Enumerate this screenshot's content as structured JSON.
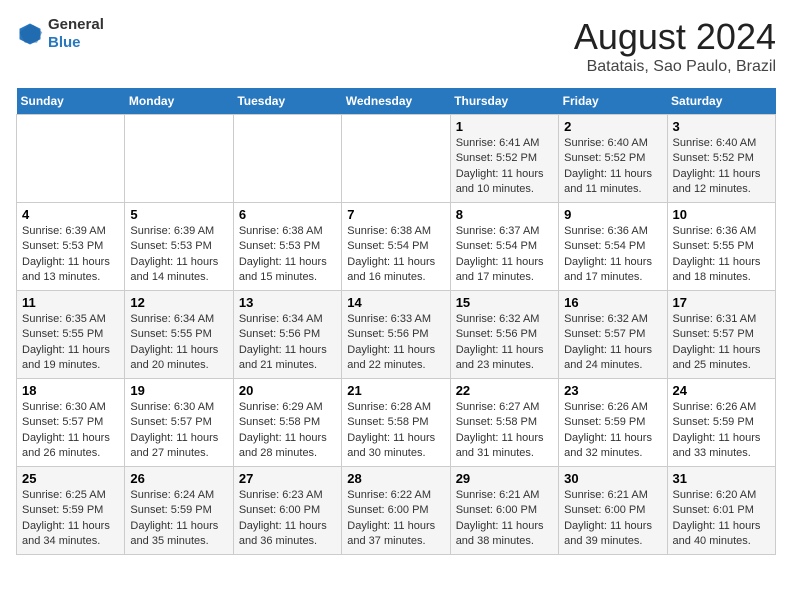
{
  "header": {
    "logo_line1": "General",
    "logo_line2": "Blue",
    "title": "August 2024",
    "subtitle": "Batatais, Sao Paulo, Brazil"
  },
  "calendar": {
    "days_of_week": [
      "Sunday",
      "Monday",
      "Tuesday",
      "Wednesday",
      "Thursday",
      "Friday",
      "Saturday"
    ],
    "weeks": [
      [
        {
          "day": "",
          "info": ""
        },
        {
          "day": "",
          "info": ""
        },
        {
          "day": "",
          "info": ""
        },
        {
          "day": "",
          "info": ""
        },
        {
          "day": "1",
          "info": "Sunrise: 6:41 AM\nSunset: 5:52 PM\nDaylight: 11 hours\nand 10 minutes."
        },
        {
          "day": "2",
          "info": "Sunrise: 6:40 AM\nSunset: 5:52 PM\nDaylight: 11 hours\nand 11 minutes."
        },
        {
          "day": "3",
          "info": "Sunrise: 6:40 AM\nSunset: 5:52 PM\nDaylight: 11 hours\nand 12 minutes."
        }
      ],
      [
        {
          "day": "4",
          "info": "Sunrise: 6:39 AM\nSunset: 5:53 PM\nDaylight: 11 hours\nand 13 minutes."
        },
        {
          "day": "5",
          "info": "Sunrise: 6:39 AM\nSunset: 5:53 PM\nDaylight: 11 hours\nand 14 minutes."
        },
        {
          "day": "6",
          "info": "Sunrise: 6:38 AM\nSunset: 5:53 PM\nDaylight: 11 hours\nand 15 minutes."
        },
        {
          "day": "7",
          "info": "Sunrise: 6:38 AM\nSunset: 5:54 PM\nDaylight: 11 hours\nand 16 minutes."
        },
        {
          "day": "8",
          "info": "Sunrise: 6:37 AM\nSunset: 5:54 PM\nDaylight: 11 hours\nand 17 minutes."
        },
        {
          "day": "9",
          "info": "Sunrise: 6:36 AM\nSunset: 5:54 PM\nDaylight: 11 hours\nand 17 minutes."
        },
        {
          "day": "10",
          "info": "Sunrise: 6:36 AM\nSunset: 5:55 PM\nDaylight: 11 hours\nand 18 minutes."
        }
      ],
      [
        {
          "day": "11",
          "info": "Sunrise: 6:35 AM\nSunset: 5:55 PM\nDaylight: 11 hours\nand 19 minutes."
        },
        {
          "day": "12",
          "info": "Sunrise: 6:34 AM\nSunset: 5:55 PM\nDaylight: 11 hours\nand 20 minutes."
        },
        {
          "day": "13",
          "info": "Sunrise: 6:34 AM\nSunset: 5:56 PM\nDaylight: 11 hours\nand 21 minutes."
        },
        {
          "day": "14",
          "info": "Sunrise: 6:33 AM\nSunset: 5:56 PM\nDaylight: 11 hours\nand 22 minutes."
        },
        {
          "day": "15",
          "info": "Sunrise: 6:32 AM\nSunset: 5:56 PM\nDaylight: 11 hours\nand 23 minutes."
        },
        {
          "day": "16",
          "info": "Sunrise: 6:32 AM\nSunset: 5:57 PM\nDaylight: 11 hours\nand 24 minutes."
        },
        {
          "day": "17",
          "info": "Sunrise: 6:31 AM\nSunset: 5:57 PM\nDaylight: 11 hours\nand 25 minutes."
        }
      ],
      [
        {
          "day": "18",
          "info": "Sunrise: 6:30 AM\nSunset: 5:57 PM\nDaylight: 11 hours\nand 26 minutes."
        },
        {
          "day": "19",
          "info": "Sunrise: 6:30 AM\nSunset: 5:57 PM\nDaylight: 11 hours\nand 27 minutes."
        },
        {
          "day": "20",
          "info": "Sunrise: 6:29 AM\nSunset: 5:58 PM\nDaylight: 11 hours\nand 28 minutes."
        },
        {
          "day": "21",
          "info": "Sunrise: 6:28 AM\nSunset: 5:58 PM\nDaylight: 11 hours\nand 30 minutes."
        },
        {
          "day": "22",
          "info": "Sunrise: 6:27 AM\nSunset: 5:58 PM\nDaylight: 11 hours\nand 31 minutes."
        },
        {
          "day": "23",
          "info": "Sunrise: 6:26 AM\nSunset: 5:59 PM\nDaylight: 11 hours\nand 32 minutes."
        },
        {
          "day": "24",
          "info": "Sunrise: 6:26 AM\nSunset: 5:59 PM\nDaylight: 11 hours\nand 33 minutes."
        }
      ],
      [
        {
          "day": "25",
          "info": "Sunrise: 6:25 AM\nSunset: 5:59 PM\nDaylight: 11 hours\nand 34 minutes."
        },
        {
          "day": "26",
          "info": "Sunrise: 6:24 AM\nSunset: 5:59 PM\nDaylight: 11 hours\nand 35 minutes."
        },
        {
          "day": "27",
          "info": "Sunrise: 6:23 AM\nSunset: 6:00 PM\nDaylight: 11 hours\nand 36 minutes."
        },
        {
          "day": "28",
          "info": "Sunrise: 6:22 AM\nSunset: 6:00 PM\nDaylight: 11 hours\nand 37 minutes."
        },
        {
          "day": "29",
          "info": "Sunrise: 6:21 AM\nSunset: 6:00 PM\nDaylight: 11 hours\nand 38 minutes."
        },
        {
          "day": "30",
          "info": "Sunrise: 6:21 AM\nSunset: 6:00 PM\nDaylight: 11 hours\nand 39 minutes."
        },
        {
          "day": "31",
          "info": "Sunrise: 6:20 AM\nSunset: 6:01 PM\nDaylight: 11 hours\nand 40 minutes."
        }
      ]
    ]
  }
}
